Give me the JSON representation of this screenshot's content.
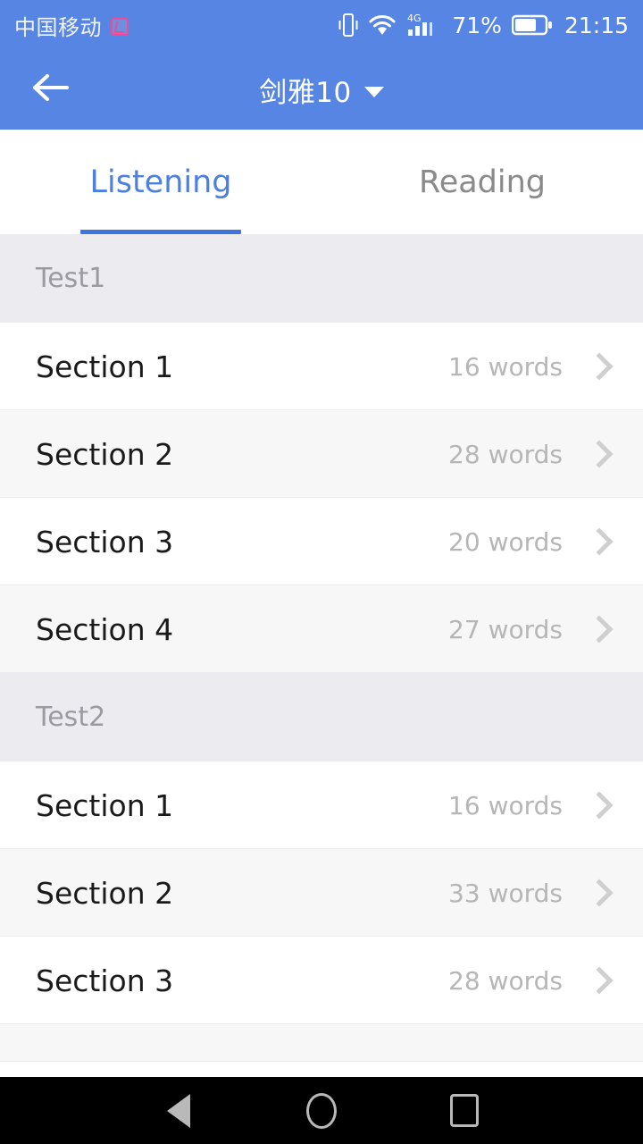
{
  "statusbar": {
    "carrier": "中国移动",
    "carrier_badge_icon": "sim-card-icon",
    "vibrate_icon": "vibrate-icon",
    "wifi_icon": "wifi-icon",
    "network_type": "4G",
    "signal_icon": "cellular-signal-icon",
    "battery_percent": "71%",
    "battery_icon": "battery-icon",
    "time": "21:15"
  },
  "appbar": {
    "back_icon": "back-arrow-icon",
    "title": "剑雅10",
    "dropdown_icon": "caret-down-icon"
  },
  "tabs": {
    "items": [
      {
        "label": "Listening",
        "active": true
      },
      {
        "label": "Reading",
        "active": false
      }
    ]
  },
  "colors": {
    "header_blue": "#5685E3",
    "tab_active": "#4B7FE0",
    "tab_underline": "#3D74DD",
    "tab_inactive": "#8A8A8A",
    "group_header_bg": "#ECECF0",
    "group_header_text": "#9A9AA0",
    "row_title": "#1A1A1A",
    "row_count": "#B6B6B6",
    "chevron": "#CFCFCF",
    "row_alt_bg": "#F7F7F8",
    "navbar_bg": "#000000"
  },
  "list": {
    "groups": [
      {
        "title": "Test1",
        "rows": [
          {
            "title": "Section 1",
            "count": "16 words",
            "chevron_icon": "chevron-right-icon"
          },
          {
            "title": "Section 2",
            "count": "28 words",
            "chevron_icon": "chevron-right-icon"
          },
          {
            "title": "Section 3",
            "count": "20 words",
            "chevron_icon": "chevron-right-icon"
          },
          {
            "title": "Section 4",
            "count": "27 words",
            "chevron_icon": "chevron-right-icon"
          }
        ]
      },
      {
        "title": "Test2",
        "rows": [
          {
            "title": "Section 1",
            "count": "16 words",
            "chevron_icon": "chevron-right-icon"
          },
          {
            "title": "Section 2",
            "count": "33 words",
            "chevron_icon": "chevron-right-icon"
          },
          {
            "title": "Section 3",
            "count": "28 words",
            "chevron_icon": "chevron-right-icon"
          }
        ]
      }
    ]
  },
  "navbar": {
    "back_icon": "nav-back-icon",
    "home_icon": "nav-home-icon",
    "recents_icon": "nav-recents-icon"
  }
}
